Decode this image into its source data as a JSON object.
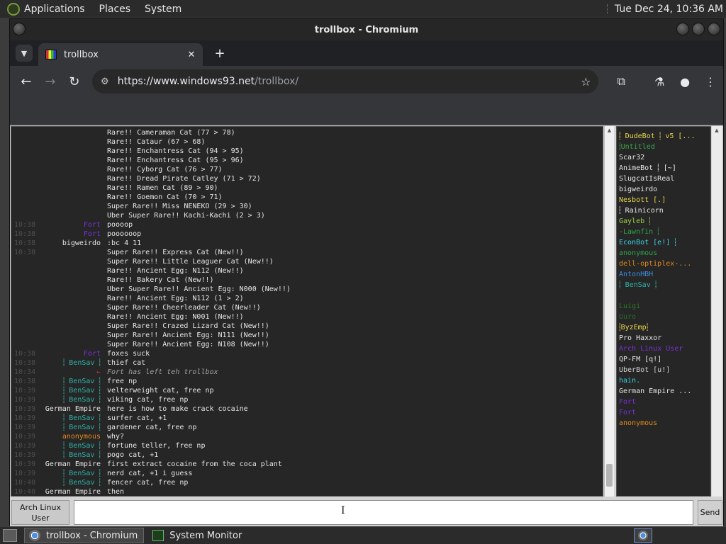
{
  "top_panel": {
    "menus": [
      "Applications",
      "Places",
      "System"
    ],
    "clock": "Tue Dec 24, 10:36 AM"
  },
  "window": {
    "title": "trollbox - Chromium"
  },
  "tabs": {
    "active": {
      "title": "trollbox"
    }
  },
  "toolbar": {
    "back_icon": "←",
    "forward_icon": "→",
    "reload_icon": "↻",
    "url_host": "https://www.windows93.net",
    "url_path": "/trollbox/",
    "star_icon": "☆",
    "extensions_icon": "⧉",
    "labs_icon": "⚗",
    "profile_icon": "●",
    "menu_icon": "⋮"
  },
  "chat": {
    "messages": [
      {
        "time": "",
        "nick": "",
        "nick_color": "#fff",
        "text": "Rare!! Cameraman Cat (77 > 78)"
      },
      {
        "time": "",
        "nick": "",
        "nick_color": "#fff",
        "text": "Rare!! Cataur (67 > 68)"
      },
      {
        "time": "",
        "nick": "",
        "nick_color": "#fff",
        "text": "Rare!! Enchantress Cat (94 > 95)"
      },
      {
        "time": "",
        "nick": "",
        "nick_color": "#fff",
        "text": "Rare!! Enchantress Cat (95 > 96)"
      },
      {
        "time": "",
        "nick": "",
        "nick_color": "#fff",
        "text": "Rare!! Cyborg Cat (76 > 77)"
      },
      {
        "time": "",
        "nick": "",
        "nick_color": "#fff",
        "text": "Rare!! Dread Pirate Catley (71 > 72)"
      },
      {
        "time": "",
        "nick": "",
        "nick_color": "#fff",
        "text": "Rare!! Ramen Cat (89 > 90)"
      },
      {
        "time": "",
        "nick": "",
        "nick_color": "#fff",
        "text": "Rare!! Goemon Cat (70 > 71)"
      },
      {
        "time": "",
        "nick": "",
        "nick_color": "#fff",
        "text": "Super Rare!! Miss NENEKO (29 > 30)"
      },
      {
        "time": "",
        "nick": "",
        "nick_color": "#fff",
        "text": "Uber Super Rare!! Kachi-Kachi (2 > 3)"
      },
      {
        "time": "10:38",
        "nick": "Fort",
        "nick_color": "#7a2fd6",
        "text": "poooop"
      },
      {
        "time": "10:38",
        "nick": "Fort",
        "nick_color": "#7a2fd6",
        "text": "poooooop"
      },
      {
        "time": "10:38",
        "nick": "bigweirdo",
        "nick_color": "#e6e6e6",
        "text": ":bc 4 11"
      },
      {
        "time": "10:38",
        "nick": "",
        "nick_color": "#3b2c6e",
        "text": "Super Rare!! Express Cat (New!!)"
      },
      {
        "time": "",
        "nick": "",
        "nick_color": "#fff",
        "text": "Super Rare!! Little Leaguer Cat (New!!)"
      },
      {
        "time": "",
        "nick": "",
        "nick_color": "#fff",
        "text": "Rare!! Ancient Egg: N112 (New!!)"
      },
      {
        "time": "",
        "nick": "",
        "nick_color": "#fff",
        "text": "Rare!! Bakery Cat (New!!)"
      },
      {
        "time": "",
        "nick": "",
        "nick_color": "#fff",
        "text": "Uber Super Rare!! Ancient Egg: N000 (New!!)"
      },
      {
        "time": "",
        "nick": "",
        "nick_color": "#fff",
        "text": "Rare!! Ancient Egg: N112 (1 > 2)"
      },
      {
        "time": "",
        "nick": "",
        "nick_color": "#fff",
        "text": "Super Rare!! Cheerleader Cat (New!!)"
      },
      {
        "time": "",
        "nick": "",
        "nick_color": "#fff",
        "text": "Rare!! Ancient Egg: N001 (New!!)"
      },
      {
        "time": "",
        "nick": "",
        "nick_color": "#fff",
        "text": "Super Rare!! Crazed Lizard Cat (New!!)"
      },
      {
        "time": "",
        "nick": "",
        "nick_color": "#fff",
        "text": "Super Rare!! Ancient Egg: N111 (New!!)"
      },
      {
        "time": "",
        "nick": "",
        "nick_color": "#fff",
        "text": "Super Rare!! Ancient Egg: N108 (New!!)"
      },
      {
        "time": "10:38",
        "nick": "Fort",
        "nick_color": "#7a2fd6",
        "text": "foxes suck"
      },
      {
        "time": "10:38",
        "nick": "⸽ BenSav ⸽",
        "nick_color": "#2fb3a8",
        "text": "thief cat"
      },
      {
        "time": "10:34",
        "nick": "←",
        "nick_color": "#c0392b",
        "text": "Fort has left teh trollbox",
        "system": true
      },
      {
        "time": "10:38",
        "nick": "⸽ BenSav ⸽",
        "nick_color": "#2fb3a8",
        "text": "free np"
      },
      {
        "time": "10:39",
        "nick": "⸽ BenSav ⸽",
        "nick_color": "#2fb3a8",
        "text": "velterweight cat, free np"
      },
      {
        "time": "10:39",
        "nick": "⸽ BenSav ⸽",
        "nick_color": "#2fb3a8",
        "text": "viking cat, free np"
      },
      {
        "time": "10:39",
        "nick": "German Empire",
        "nick_color": "#e6e6e6",
        "text": "here is how to make crack cocaine"
      },
      {
        "time": "10:39",
        "nick": "⸽ BenSav ⸽",
        "nick_color": "#2fb3a8",
        "text": "surfer cat, +1"
      },
      {
        "time": "10:39",
        "nick": "⸽ BenSav ⸽",
        "nick_color": "#2fb3a8",
        "text": "gardener cat, free np"
      },
      {
        "time": "10:39",
        "nick": "anonymous",
        "nick_color": "#e08a1e",
        "text": "why?"
      },
      {
        "time": "10:39",
        "nick": "⸽ BenSav ⸽",
        "nick_color": "#2fb3a8",
        "text": "fortune teller, free np"
      },
      {
        "time": "10:39",
        "nick": "⸽ BenSav ⸽",
        "nick_color": "#2fb3a8",
        "text": "pogo cat, +1"
      },
      {
        "time": "10:39",
        "nick": "German Empire",
        "nick_color": "#e6e6e6",
        "text": "first extract cocaine from the coca plant"
      },
      {
        "time": "10:39",
        "nick": "⸽ BenSav ⸽",
        "nick_color": "#2fb3a8",
        "text": "nerd cat, +1 i guess"
      },
      {
        "time": "10:40",
        "nick": "⸽ BenSav ⸽",
        "nick_color": "#2fb3a8",
        "text": "fencer cat, free np"
      },
      {
        "time": "10:40",
        "nick": "German Empire",
        "nick_color": "#e6e6e6",
        "text": "then"
      }
    ]
  },
  "users": [
    {
      "name": "⸽ DudeBot ⸽ v5 [...",
      "color": "#e8d44d"
    },
    {
      "name": "⸽Untitled",
      "color": "#3aa34a"
    },
    {
      "name": "Scar32",
      "color": "#e6e6e6"
    },
    {
      "name": "AnimeBot ⸽ [~]",
      "color": "#e6e6e6"
    },
    {
      "name": "SlugcatIsReal",
      "color": "#e6e6e6"
    },
    {
      "name": "bigweirdo",
      "color": "#e6e6e6"
    },
    {
      "name": "Nesbott [.]",
      "color": "#e8d44d"
    },
    {
      "name": "⸽ Rainicorn",
      "color": "#e6e6e6"
    },
    {
      "name": "Gayleb ⸽",
      "color": "#9bd142"
    },
    {
      "name": "-Lawnfin ⸽",
      "color": "#2fa34a"
    },
    {
      "name": "EconBot [e!] ⸽",
      "color": "#3ad1e0"
    },
    {
      "name": "anonymous",
      "color": "#2fa34a"
    },
    {
      "name": "dell-optiplex-...",
      "color": "#e08a1e"
    },
    {
      "name": "AntonHBH",
      "color": "#3a8de0"
    },
    {
      "name": "⸽ BenSav ⸽",
      "color": "#2fb3a8"
    },
    {
      "name": "",
      "color": "#3b2c6e"
    },
    {
      "name": "Luigi",
      "color": "#2a7a2a"
    },
    {
      "name": "Uuro",
      "color": "#2a6a2a"
    },
    {
      "name": "⸽ByzEmp⸽",
      "color": "#e8d44d"
    },
    {
      "name": "Pro Haxxor",
      "color": "#e6e6e6"
    },
    {
      "name": "Arch Linux User",
      "color": "#7a2fd6"
    },
    {
      "name": "QP-FM [q!]",
      "color": "#e6e6e6"
    },
    {
      "name": "UberBot [u!]",
      "color": "#cfcfcf"
    },
    {
      "name": "hain.",
      "color": "#3ad1e0"
    },
    {
      "name": "German Empire ...",
      "color": "#e6e6e6"
    },
    {
      "name": "Fort",
      "color": "#7a2fd6"
    },
    {
      "name": "Fort",
      "color": "#7a2fd6"
    },
    {
      "name": "anonymous",
      "color": "#e08a1e"
    }
  ],
  "input": {
    "nick_label_line1": "Arch Linux",
    "nick_label_line2": "User",
    "placeholder": "",
    "send_label": "Send"
  },
  "taskbar": {
    "tasks": [
      "trollbox - Chromium",
      "System Monitor"
    ]
  }
}
